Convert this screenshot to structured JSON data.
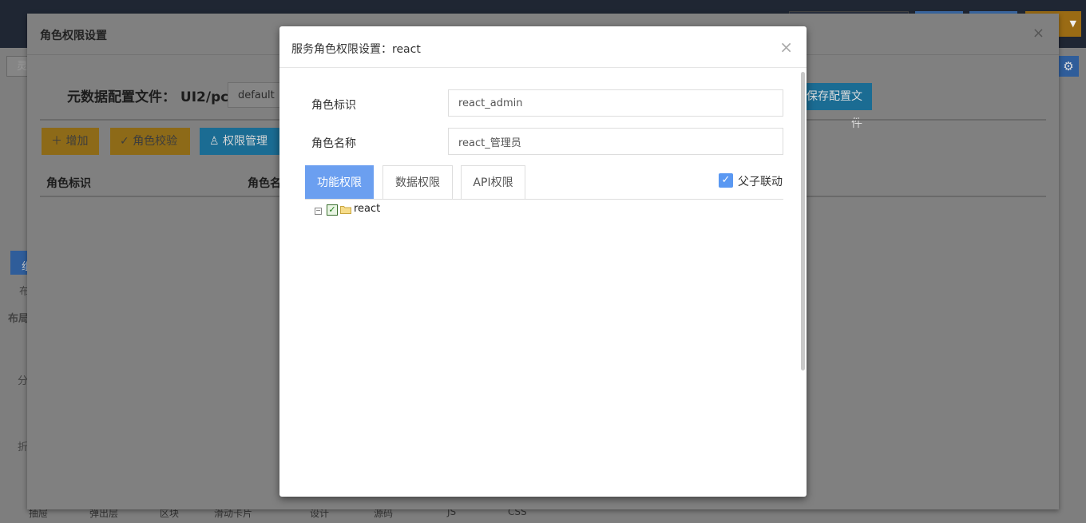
{
  "background": {
    "side_input_text": "灵",
    "side_labels": [
      "组",
      "布",
      "布局",
      "分",
      "折"
    ],
    "bottom_tabs": [
      "抽屉",
      "弹出层",
      "区块",
      "滑动卡片",
      "设计",
      "源码",
      "JS",
      "CSS"
    ]
  },
  "outer_dialog": {
    "title": "角色权限设置",
    "close": "×",
    "config_label": "元数据配置文件： UI2/pc/",
    "config_select": "default",
    "save_button": "保存配置文件",
    "buttons": {
      "add": "增加",
      "check": "角色校验",
      "perm": "权限管理"
    },
    "table_headers": [
      "角色标识",
      "角色名"
    ]
  },
  "modal": {
    "title": "服务角色权限设置：react",
    "close": "×",
    "fields": {
      "role_id_label": "角色标识",
      "role_id_value": "react_admin",
      "role_name_label": "角色名称",
      "role_name_value": "react_管理员"
    },
    "tabs": [
      "功能权限",
      "数据权限",
      "API权限"
    ],
    "active_tab": "功能权限",
    "linkage_label": "父子联动",
    "linkage_checked": true,
    "tree": [
      {
        "label": "react",
        "checked": true,
        "expanded": true
      }
    ]
  },
  "colors": {
    "tab_active": "#6b9ff0",
    "checkbox": "#5a98f2",
    "folder": "#f4d37a"
  }
}
